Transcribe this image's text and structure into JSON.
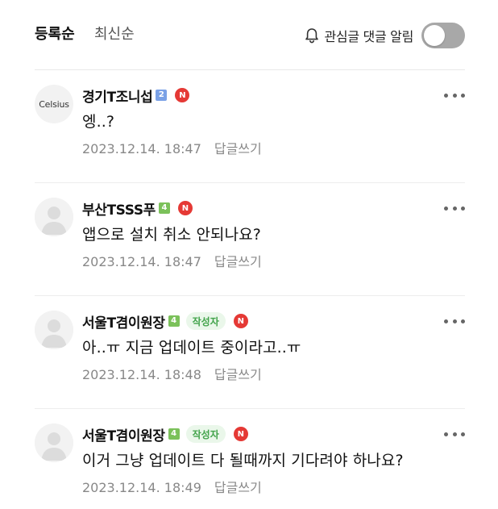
{
  "sort": {
    "registered_label": "등록순",
    "latest_label": "최신순"
  },
  "notify": {
    "label": "관심글 댓글 알림",
    "enabled": false,
    "icon": "bell-icon"
  },
  "comments": [
    {
      "avatar_text": "Celsius",
      "nickname": "경기T조니섭",
      "level": "2",
      "is_writer": false,
      "writer_label": "",
      "new_badge": "N",
      "text": "엥..?",
      "date": "2023.12.14. 18:47",
      "reply_label": "답글쓰기"
    },
    {
      "avatar_text": "",
      "nickname": "부산TSSS푸",
      "level": "4",
      "is_writer": false,
      "writer_label": "",
      "new_badge": "N",
      "text": "앱으로 설치 취소 안되나요?",
      "date": "2023.12.14. 18:47",
      "reply_label": "답글쓰기"
    },
    {
      "avatar_text": "",
      "nickname": "서울T겸이원장",
      "level": "4",
      "is_writer": true,
      "writer_label": "작성자",
      "new_badge": "N",
      "text": "아..ㅠ 지금 업데이트 중이라고..ㅠ",
      "date": "2023.12.14. 18:48",
      "reply_label": "답글쓰기"
    },
    {
      "avatar_text": "",
      "nickname": "서울T겸이원장",
      "level": "4",
      "is_writer": true,
      "writer_label": "작성자",
      "new_badge": "N",
      "text": "이거 그냥 업데이트 다 될때까지 기다려야 하나요?",
      "date": "2023.12.14. 18:49",
      "reply_label": "답글쓰기"
    }
  ],
  "colors": {
    "writer_badge_bg": "#eaf7ea",
    "writer_badge_text": "#41a34a",
    "new_badge": "#e53935",
    "level_2": "#7aa1e6",
    "level_4": "#7bc15a"
  }
}
